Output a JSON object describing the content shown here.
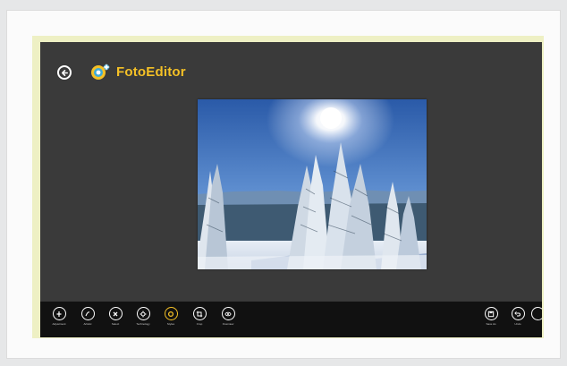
{
  "app": {
    "title": "FotoEditor"
  },
  "toolbar": {
    "left_items": [
      {
        "label": "Adjustment",
        "icon": "adjust-icon"
      },
      {
        "label": "Artistic",
        "icon": "artistic-icon"
      },
      {
        "label": "Select",
        "icon": "select-icon"
      },
      {
        "label": "Technology",
        "icon": "technology-icon"
      },
      {
        "label": "Styles",
        "icon": "styles-icon",
        "active": true
      },
      {
        "label": "Crop",
        "icon": "crop-icon"
      },
      {
        "label": "Overview",
        "icon": "overview-icon"
      }
    ],
    "right_items": [
      {
        "label": "Save As",
        "icon": "save-icon"
      },
      {
        "label": "Undo",
        "icon": "undo-icon"
      }
    ]
  },
  "colors": {
    "accent": "#f4c026",
    "canvas": "#3a3a3a",
    "appbar": "#111111",
    "border": "#eef0c4"
  }
}
